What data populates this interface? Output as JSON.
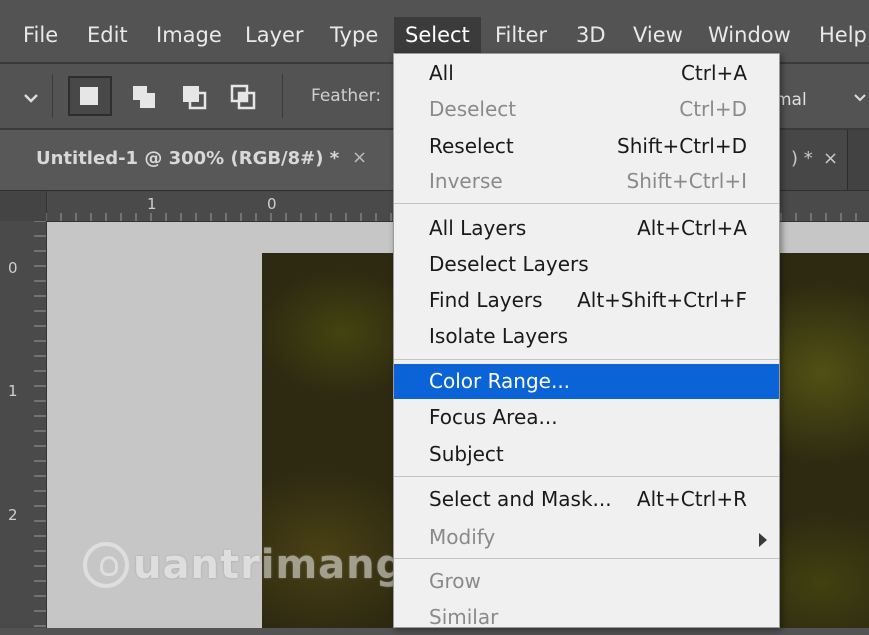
{
  "menubar": {
    "items": [
      "File",
      "Edit",
      "Image",
      "Layer",
      "Type",
      "Select",
      "Filter",
      "3D",
      "View",
      "Window",
      "Help"
    ]
  },
  "options": {
    "feather_label": "Feather:",
    "blend_mode_partial": "mal"
  },
  "document": {
    "tab_title": "Untitled-1 @ 300% (RGB/8#) *",
    "second_tab_suffix": ") *"
  },
  "rulers": {
    "top": [
      "1",
      "0"
    ],
    "left": [
      "0",
      "1",
      "2"
    ]
  },
  "watermark": {
    "text": "uantrimang"
  },
  "select_menu": {
    "items": [
      {
        "label": "All",
        "shortcut": "Ctrl+A",
        "enabled": true
      },
      {
        "label": "Deselect",
        "shortcut": "Ctrl+D",
        "enabled": false
      },
      {
        "label": "Reselect",
        "shortcut": "Shift+Ctrl+D",
        "enabled": true
      },
      {
        "label": "Inverse",
        "shortcut": "Shift+Ctrl+I",
        "enabled": false
      },
      {
        "label": "All Layers",
        "shortcut": "Alt+Ctrl+A",
        "enabled": true
      },
      {
        "label": "Deselect Layers",
        "shortcut": "",
        "enabled": true
      },
      {
        "label": "Find Layers",
        "shortcut": "Alt+Shift+Ctrl+F",
        "enabled": true
      },
      {
        "label": "Isolate Layers",
        "shortcut": "",
        "enabled": true
      },
      {
        "label": "Color Range...",
        "shortcut": "",
        "enabled": true,
        "highlighted": true
      },
      {
        "label": "Focus Area...",
        "shortcut": "",
        "enabled": true
      },
      {
        "label": "Subject",
        "shortcut": "",
        "enabled": true
      },
      {
        "label": "Select and Mask...",
        "shortcut": "Alt+Ctrl+R",
        "enabled": true
      },
      {
        "label": "Modify",
        "shortcut": "",
        "enabled": false,
        "submenu": true
      },
      {
        "label": "Grow",
        "shortcut": "",
        "enabled": false
      },
      {
        "label": "Similar",
        "shortcut": "",
        "enabled": false
      }
    ]
  },
  "colors": {
    "highlight": "#0a64d7",
    "menu_bg": "#f0f0f0",
    "chrome": "#535353"
  }
}
